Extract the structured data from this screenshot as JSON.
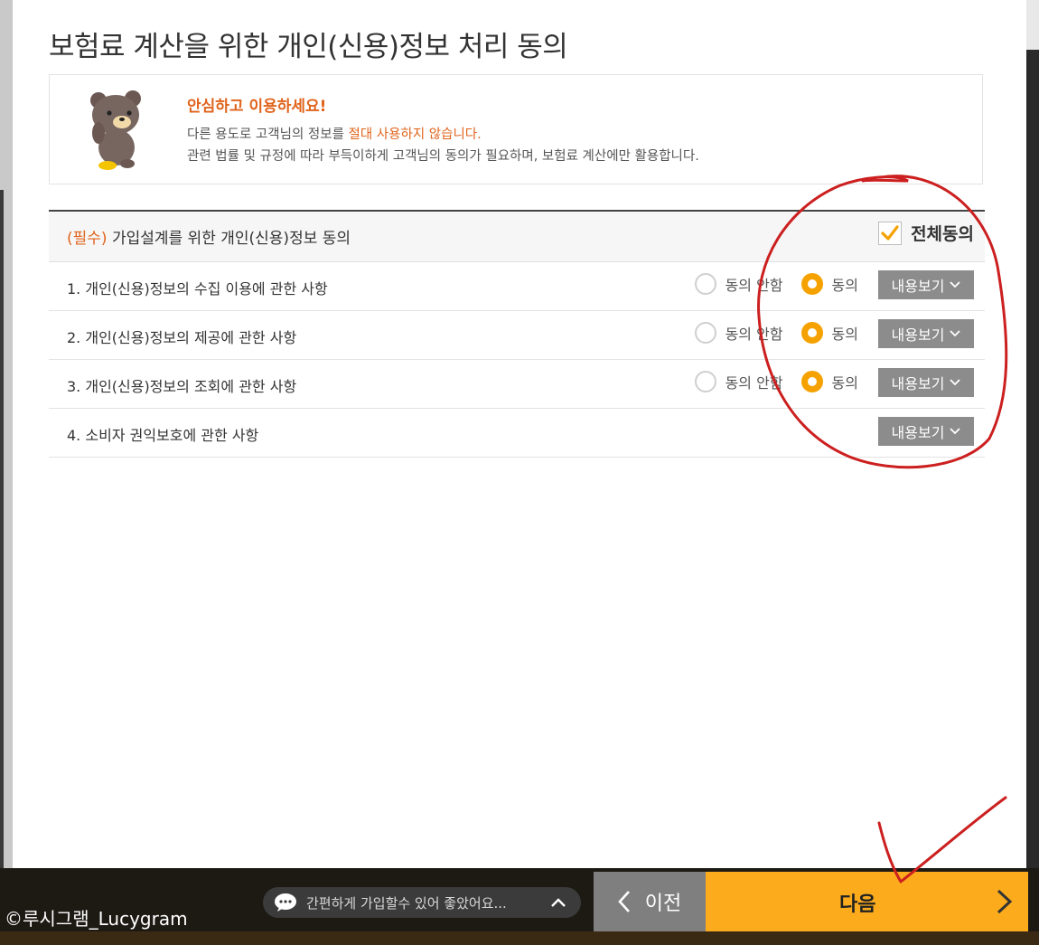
{
  "page_title": "보험료 계산을 위한 개인(신용)정보 처리 동의",
  "notice": {
    "title": "안심하고 이용하세요!",
    "line1_prefix": "다른 용도로 고객님의 정보를 ",
    "line1_emphasis": "절대 사용하지 않습니다.",
    "line2": "관련 법률 및 규정에 따라 부득이하게 고객님의 동의가 필요하며, 보험료 계산에만 활용합니다."
  },
  "consent": {
    "required_tag": "(필수)",
    "header_label": " 가입설계를 위한 개인(신용)정보 동의",
    "agree_all_label": "전체동의",
    "agree_all_checked": true,
    "disagree_label": "동의 안함",
    "agree_label": "동의",
    "view_label": "내용보기",
    "rows": [
      {
        "label": "1. 개인(신용)정보의 수집 이용에 관한 사항",
        "selected": "agree"
      },
      {
        "label": "2. 개인(신용)정보의 제공에 관한 사항",
        "selected": "agree"
      },
      {
        "label": "3. 개인(신용)정보의 조회에 관한 사항",
        "selected": "agree"
      },
      {
        "label": "4. 소비자 권익보호에 관한 사항"
      }
    ]
  },
  "footer": {
    "chat_text": "간편하게 가입할수 있어 좋았어요...",
    "prev_label": "이전",
    "next_label": "다음"
  },
  "watermark": "©루시그램_Lucygram",
  "colors": {
    "accent_orange": "#f5a100",
    "emphasis_orange": "#e0641c",
    "next_button": "#fbab1c",
    "prev_button": "#7f7f7f",
    "view_button": "#8c8c8c",
    "annotation_red": "#cc1f1f"
  }
}
